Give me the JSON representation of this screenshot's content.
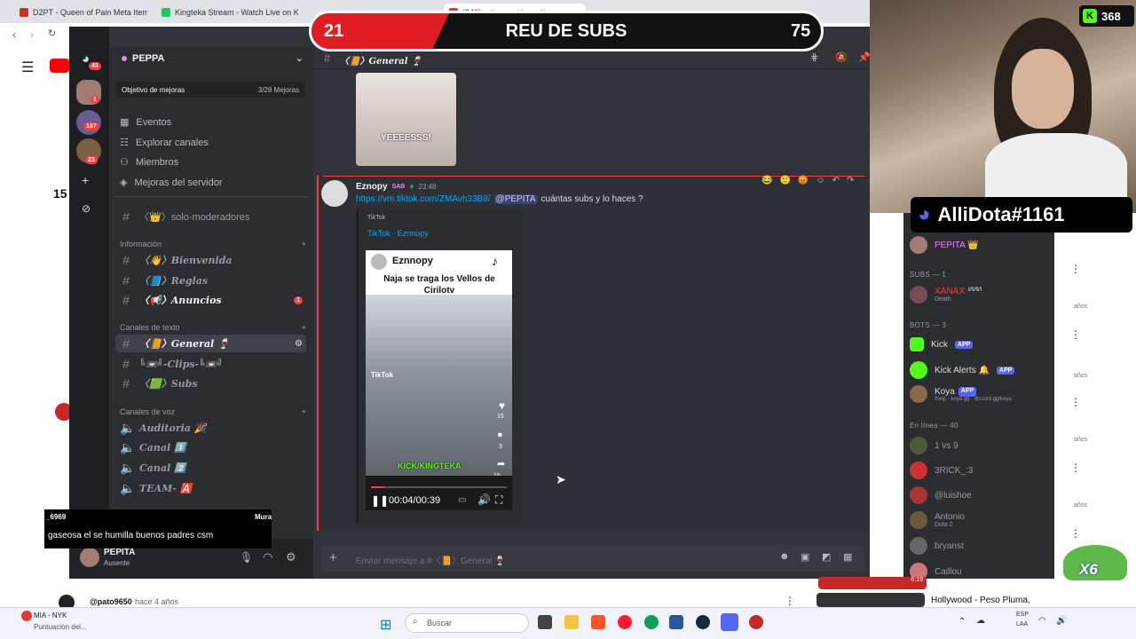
{
  "browser": {
    "tabs": [
      {
        "label": "D2PT - Queen of Pain Meta Item Bu",
        "color": "#c0392b"
      },
      {
        "label": "Kingteka Stream - Watch Live on Kick",
        "color": "#22c55e"
      },
      {
        "label": "(240) esta canción es tiernamen",
        "color": "#e53935"
      }
    ]
  },
  "banner": {
    "left_score": "21",
    "title": "REU DE SUBS",
    "right_score": "75"
  },
  "kick_viewers": "368",
  "discord_handle": "AlliDota#1161",
  "server": {
    "name": "PEPPA",
    "goal_label": "Objetivo de mejoras",
    "goal_progress": "3/28 Mejoras",
    "goal_fraction": 0.107,
    "nav": [
      "Eventos",
      "Explorar canales",
      "Miembros",
      "Mejoras del servidor"
    ],
    "server_badges": [
      "43",
      "1",
      "187",
      "23"
    ]
  },
  "channels": {
    "top": [
      {
        "name": "〈👑〉solo-moderadores"
      }
    ],
    "info_header": "Información",
    "info": [
      {
        "name": "〈👋〉Bienvenida"
      },
      {
        "name": "〈📘〉Reglas"
      },
      {
        "name": "〈📢〉Anuncios",
        "badge": "1"
      }
    ],
    "text_header": "Canales de texto",
    "text": [
      {
        "name": "〈📙〉General 🍷",
        "selected": true
      },
      {
        "name": "╚📼╝-Clips-╚📼╝"
      },
      {
        "name": "〈🟩〉Subs"
      }
    ],
    "voice_header": "Canales de voz",
    "voice": [
      {
        "name": "Auditoria 🎉"
      },
      {
        "name": "Canal 1️⃣"
      },
      {
        "name": "Canal 2️⃣"
      },
      {
        "name": "TEAM- 🅰️"
      }
    ]
  },
  "user_panel": {
    "name": "PEPITA",
    "status": "Ausente"
  },
  "chat": {
    "channel_title": "〈📙〉General 🍷",
    "gif_caption": "YEEEESSS!",
    "message": {
      "author": "Eznopy",
      "tag": "SAB",
      "time": "23:48",
      "link": "https://vm.tiktok.com/ZMAvh33B8/",
      "mention": "@PEPITA",
      "text": "cuántas subs y lo haces ?"
    },
    "embed": {
      "provider": "TikTok",
      "title": "TikTok · Eznnopy",
      "video_user": "Eznnopy",
      "video_caption": "Naja se traga los Vellos de Cirilotv",
      "watermark": "TikTok",
      "overlay_text": "KICK/KINGTEKA",
      "likes": "15",
      "comments": "3",
      "shares": "15",
      "time_display": "00:04/00:39",
      "progress": 0.1
    },
    "input_placeholder": "Enviar mensaje a #〈📙〉General 🍷"
  },
  "members": {
    "top_user": "PEPITA 👑",
    "subs_header": "SUBS — 1",
    "subs": [
      {
        "name": "XANAX",
        "sub": "Death",
        "tag": "ИИИ"
      }
    ],
    "bots_header": "BOTS — 3",
    "bots": [
      {
        "name": "Kick",
        "app": "APP"
      },
      {
        "name": "Kick Alerts 🔔",
        "app": "APP"
      },
      {
        "name": "Koya",
        "app": "APP",
        "sub": "/help · koya.gg · discord.gg/koya"
      }
    ],
    "online_header": "En línea — 40",
    "online": [
      {
        "name": "1 vs 9"
      },
      {
        "name": "3RICK_:3"
      },
      {
        "name": "@luishoe"
      },
      {
        "name": "Antonio",
        "sub": "Dota 2"
      },
      {
        "name": "bryanst"
      },
      {
        "name": "Caillou"
      }
    ]
  },
  "stream_chat_overlay": {
    "user": "_6969",
    "right_user": "Mura",
    "text": "gaseosa el se humilla buenos padres csm"
  },
  "youtube": {
    "comment_author": "@pato9650",
    "comment_time": "hace 4 años",
    "side_left_number": "15",
    "video_title": "Hollywood - Peso Pluma,",
    "video_duration": "6:19",
    "side_labels": [
      "años",
      "años",
      "años",
      "años"
    ]
  },
  "taskbar": {
    "notification_title": "MIA - NYK",
    "notification_sub": "Puntuación del...",
    "search_placeholder": "Buscar",
    "lang": "ESP",
    "lang_sub": "LAA"
  },
  "multiplier": "X6"
}
